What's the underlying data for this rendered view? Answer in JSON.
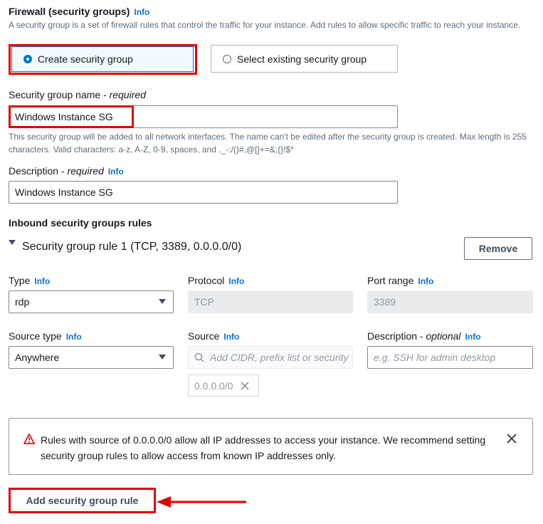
{
  "firewall": {
    "title": "Firewall (security groups)",
    "info": "Info",
    "description": "A security group is a set of firewall rules that control the traffic for your instance. Add rules to allow specific traffic to reach your instance.",
    "options": {
      "create": "Create security group",
      "existing": "Select existing security group"
    }
  },
  "sg_name": {
    "label": "Security group name",
    "required": "required",
    "value": "Windows Instance SG",
    "hint": "This security group will be added to all network interfaces. The name can't be edited after the security group is created. Max length is 255 characters. Valid characters: a-z, A-Z, 0-9, spaces, and ._-:/()#,@[]+=&;{}!$*"
  },
  "description_field": {
    "label": "Description",
    "required": "required",
    "info": "Info",
    "value": "Windows Instance SG"
  },
  "inbound": {
    "title": "Inbound security groups rules",
    "rule_title": "Security group rule 1 (TCP, 3389, 0.0.0.0/0)",
    "remove_label": "Remove",
    "type": {
      "label": "Type",
      "info": "Info",
      "value": "rdp"
    },
    "protocol": {
      "label": "Protocol",
      "info": "Info",
      "value": "TCP"
    },
    "port_range": {
      "label": "Port range",
      "info": "Info",
      "value": "3389"
    },
    "source_type": {
      "label": "Source type",
      "info": "Info",
      "value": "Anywhere"
    },
    "source": {
      "label": "Source",
      "info": "Info",
      "placeholder": "Add CIDR, prefix list or security",
      "token": "0.0.0.0/0"
    },
    "rule_description": {
      "label": "Description",
      "optional": "optional",
      "info": "Info",
      "placeholder": "e.g. SSH for admin desktop"
    }
  },
  "warning": {
    "line1": "Rules with source of 0.0.0.0/0 allow all IP addresses to access your instance. We recommend setting",
    "line2": "security group rules to allow access from known IP addresses only."
  },
  "add_rule_label": "Add security group rule",
  "colors": {
    "accent": "#0972d3",
    "highlight": "#e00000",
    "warning": "#d91515"
  }
}
